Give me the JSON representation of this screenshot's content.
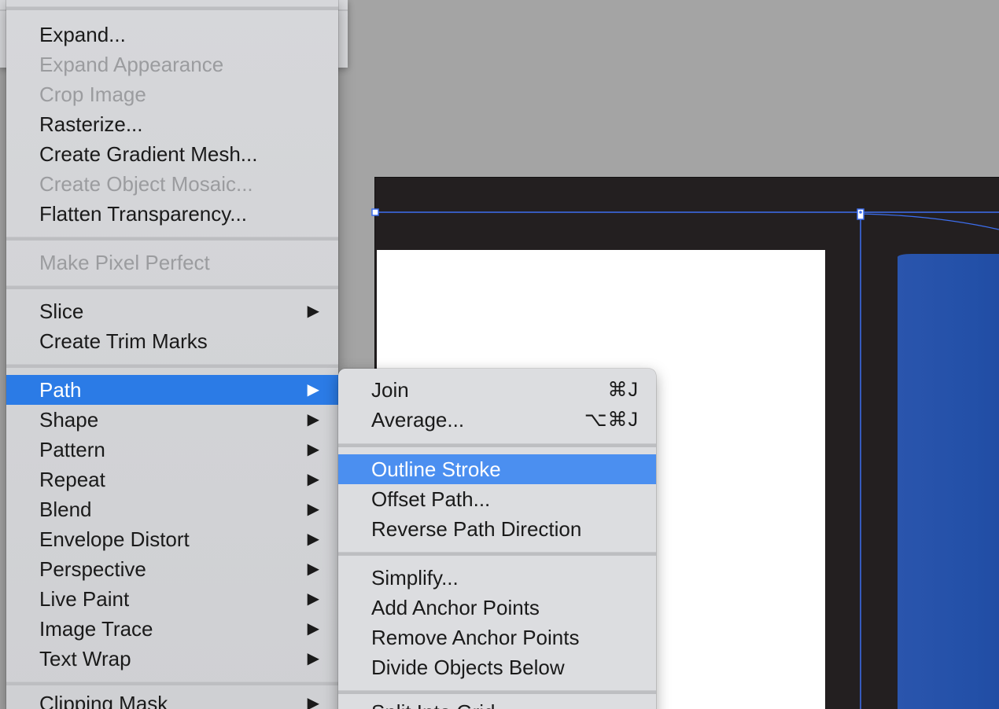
{
  "main_menu": {
    "items": [
      {
        "label": "Expand...",
        "enabled": true
      },
      {
        "label": "Expand Appearance",
        "enabled": false
      },
      {
        "label": "Crop Image",
        "enabled": false
      },
      {
        "label": "Rasterize...",
        "enabled": true
      },
      {
        "label": "Create Gradient Mesh...",
        "enabled": true
      },
      {
        "label": "Create Object Mosaic...",
        "enabled": false
      },
      {
        "label": "Flatten Transparency...",
        "enabled": true
      },
      {
        "label": "Make Pixel Perfect",
        "enabled": false
      },
      {
        "label": "Slice",
        "enabled": true,
        "submenu": true
      },
      {
        "label": "Create Trim Marks",
        "enabled": true
      },
      {
        "label": "Path",
        "enabled": true,
        "submenu": true,
        "highlighted": true
      },
      {
        "label": "Shape",
        "enabled": true,
        "submenu": true
      },
      {
        "label": "Pattern",
        "enabled": true,
        "submenu": true
      },
      {
        "label": "Repeat",
        "enabled": true,
        "submenu": true
      },
      {
        "label": "Blend",
        "enabled": true,
        "submenu": true
      },
      {
        "label": "Envelope Distort",
        "enabled": true,
        "submenu": true
      },
      {
        "label": "Perspective",
        "enabled": true,
        "submenu": true
      },
      {
        "label": "Live Paint",
        "enabled": true,
        "submenu": true
      },
      {
        "label": "Image Trace",
        "enabled": true,
        "submenu": true
      },
      {
        "label": "Text Wrap",
        "enabled": true,
        "submenu": true
      },
      {
        "label": "Clipping Mask",
        "enabled": true,
        "submenu": true
      }
    ],
    "arrow_glyph": "▶"
  },
  "path_submenu": {
    "items": [
      {
        "label": "Join",
        "shortcut": "⌘J"
      },
      {
        "label": "Average...",
        "shortcut": "⌥⌘J"
      },
      {
        "label": "Outline Stroke",
        "highlighted": true
      },
      {
        "label": "Offset Path..."
      },
      {
        "label": "Reverse Path Direction"
      },
      {
        "label": "Simplify..."
      },
      {
        "label": "Add Anchor Points"
      },
      {
        "label": "Remove Anchor Points"
      },
      {
        "label": "Divide Objects Below"
      },
      {
        "label": "Split Into Grid..."
      }
    ]
  },
  "colors": {
    "highlight": "#2b7be6",
    "submenu_highlight": "#4b8ff0",
    "menu_bg": "#d4d5d8",
    "disabled_text": "#9b9c9f",
    "artboard_dark": "#231f20",
    "selection_blue": "#3d6ff0",
    "shape_blue": "#2350a8"
  }
}
